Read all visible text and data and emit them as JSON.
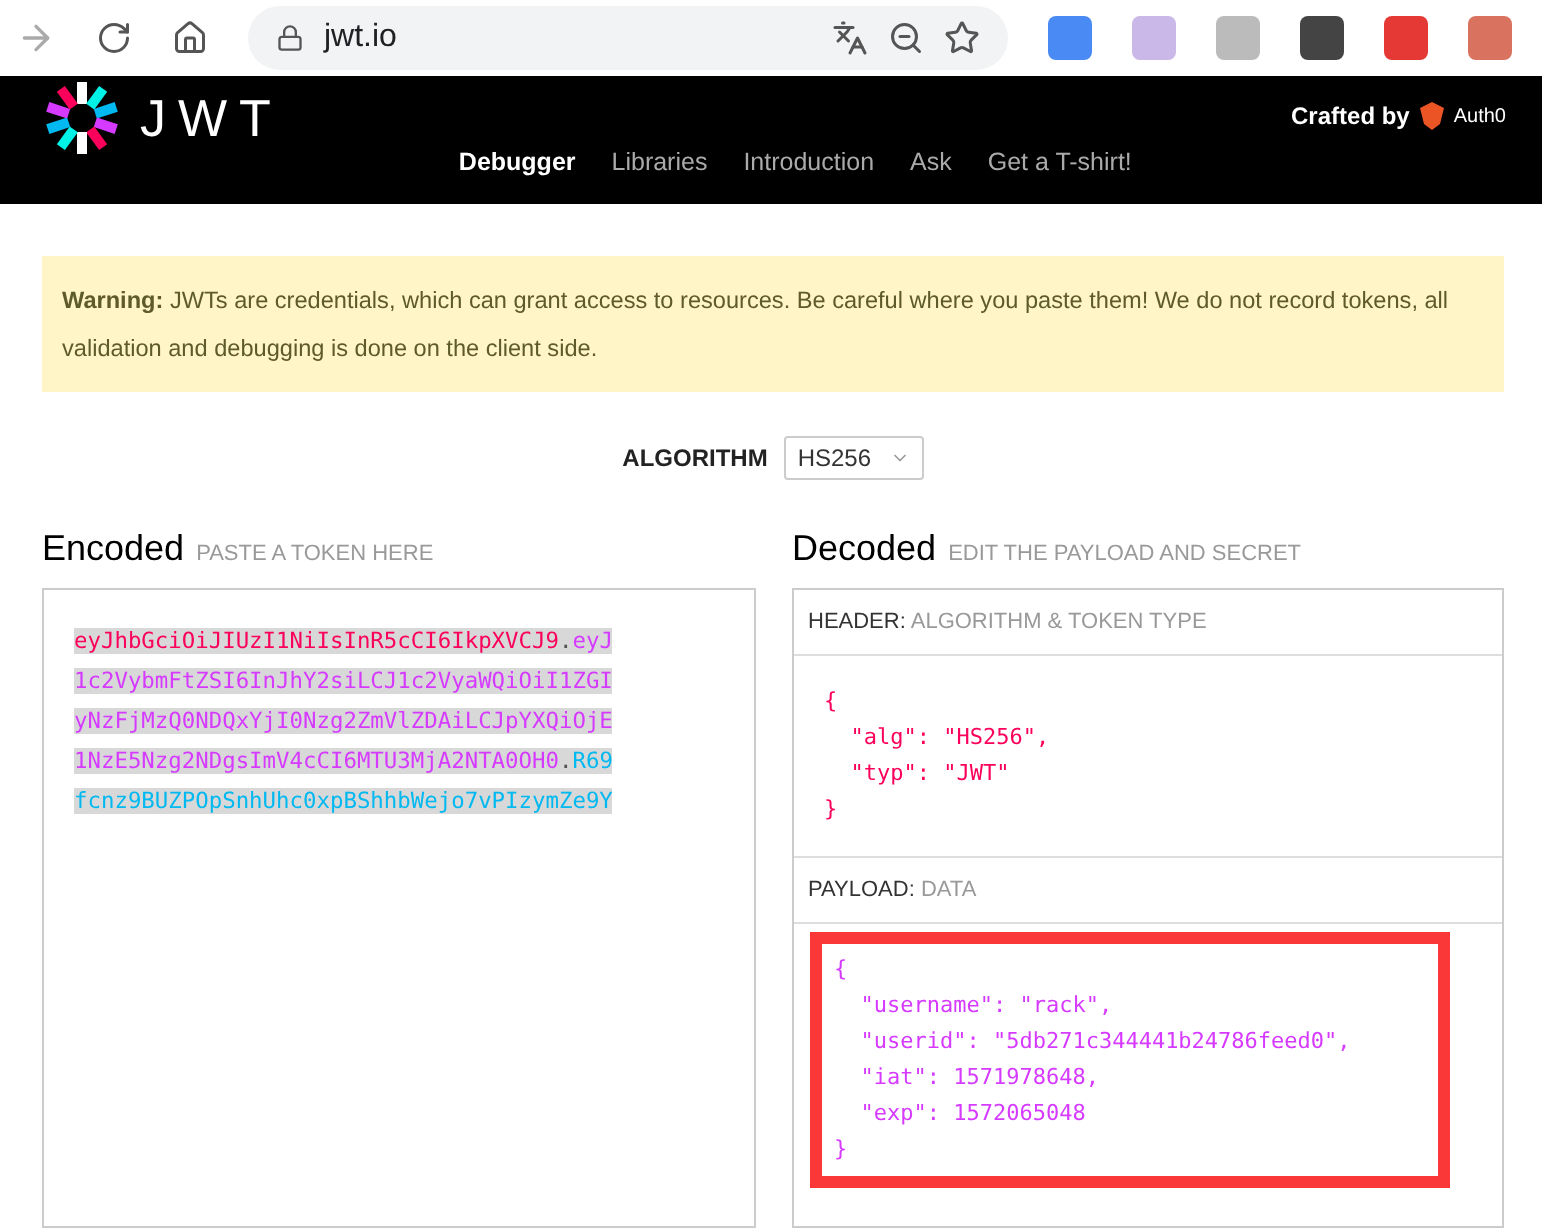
{
  "browser": {
    "address": "jwt.io"
  },
  "nav": {
    "logo_text": "JWT",
    "items": [
      {
        "label": "Debugger",
        "selected": true
      },
      {
        "label": "Libraries",
        "selected": false
      },
      {
        "label": "Introduction",
        "selected": false
      },
      {
        "label": "Ask",
        "selected": false
      },
      {
        "label": "Get a T-shirt!",
        "selected": false
      }
    ],
    "crafted_by": "Crafted by",
    "brand": "Auth0"
  },
  "warning": {
    "lead": "Warning:",
    "text": "JWTs are credentials, which can grant access to resources. Be careful where you paste them! We do not record tokens, all validation and debugging is done on the client side."
  },
  "algorithm": {
    "label": "ALGORITHM",
    "value": "HS256"
  },
  "encoded": {
    "title": "Encoded",
    "hint": "PASTE A TOKEN HERE",
    "lines": [
      [
        {
          "kind": "header",
          "text": "eyJhbGciOiJIUzI1NiIsInR5cCI6IkpXVCJ9"
        },
        {
          "kind": "dot",
          "text": "."
        },
        {
          "kind": "payload",
          "text": "eyJ"
        }
      ],
      [
        {
          "kind": "payload",
          "text": "1c2VybmFtZSI6InJhY2siLCJ1c2VyaWQiOiI1ZGI"
        }
      ],
      [
        {
          "kind": "payload",
          "text": "yNzFjMzQ0NDQxYjI0Nzg2ZmVlZDAiLCJpYXQiOjE"
        }
      ],
      [
        {
          "kind": "payload",
          "text": "1NzE5Nzg2NDgsImV4cCI6MTU3MjA2NTA0OH0"
        },
        {
          "kind": "dot",
          "text": "."
        },
        {
          "kind": "signature",
          "text": "R69"
        }
      ],
      [
        {
          "kind": "signature",
          "text": "fcnz9BUZPOpSnhUhc0xpBShhbWejo7vPIzymZe9Y"
        }
      ]
    ]
  },
  "decoded": {
    "title": "Decoded",
    "hint": "EDIT THE PAYLOAD AND SECRET",
    "header": {
      "label": "HEADER:",
      "sub": "ALGORITHM & TOKEN TYPE",
      "lines": [
        "{",
        "  \"alg\": \"HS256\",",
        "  \"typ\": \"JWT\"",
        "}"
      ]
    },
    "payload": {
      "label": "PAYLOAD:",
      "sub": "DATA",
      "highlighted": true,
      "lines": [
        "{",
        "  \"username\": \"rack\",",
        "  \"userid\": \"5db271c344441b24786feed0\",",
        "  \"iat\": 1571978648,",
        "  \"exp\": 1572065048",
        "}"
      ]
    }
  }
}
